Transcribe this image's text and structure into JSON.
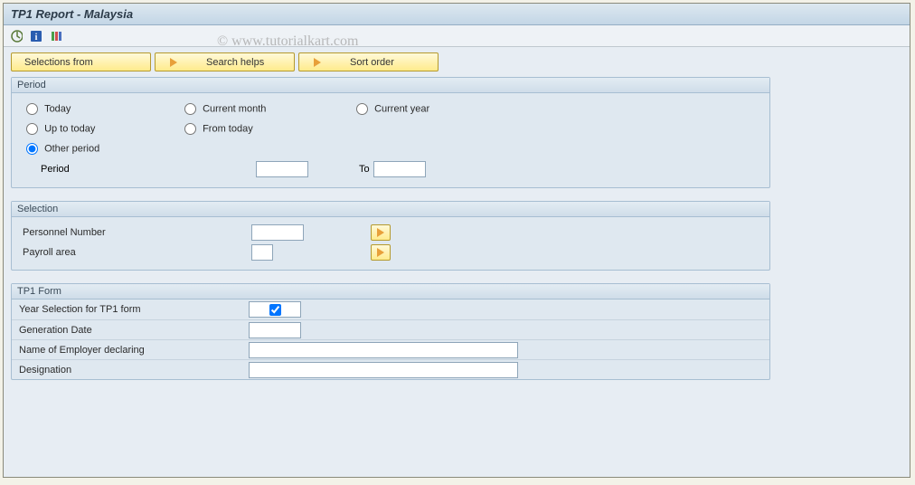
{
  "title": "TP1 Report - Malaysia",
  "watermark": "© www.tutorialkart.com",
  "buttons": {
    "selections_from": "Selections from",
    "search_helps": "Search helps",
    "sort_order": "Sort order"
  },
  "period": {
    "header": "Period",
    "today": "Today",
    "current_month": "Current month",
    "current_year": "Current year",
    "up_to_today": "Up to today",
    "from_today": "From today",
    "other_period": "Other period",
    "period_label": "Period",
    "period_from": "",
    "to_label": "To",
    "period_to": "",
    "selected": "other_period"
  },
  "selection": {
    "header": "Selection",
    "personnel_number_label": "Personnel Number",
    "personnel_number_value": "",
    "payroll_area_label": "Payroll area",
    "payroll_area_value": ""
  },
  "tp1form": {
    "header": "TP1 Form",
    "year_selection_label": "Year Selection for TP1 form",
    "year_selection_checked": true,
    "generation_date_label": "Generation Date",
    "generation_date_value": "",
    "employer_label": "Name of Employer declaring",
    "employer_value": "",
    "designation_label": "Designation",
    "designation_value": ""
  }
}
